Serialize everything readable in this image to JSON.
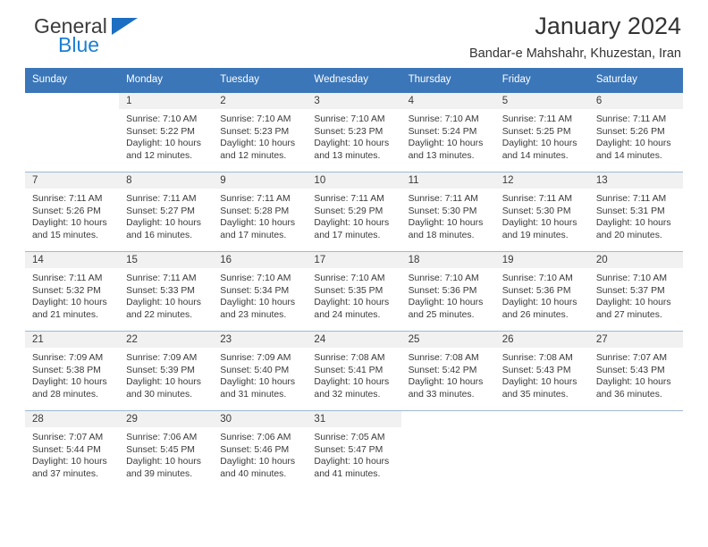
{
  "brand": {
    "name_part1": "General",
    "name_part2": "Blue",
    "accent_color": "#1b7fd4",
    "triangle_color": "#1b6ec2"
  },
  "header": {
    "title": "January 2024",
    "subtitle": "Bandar-e Mahshahr, Khuzestan, Iran"
  },
  "theme": {
    "header_row_bg": "#3b76b9",
    "daynum_bg": "#f1f1f1",
    "row_divider": "#9fb8d4",
    "text": "#3a3a3a"
  },
  "calendar": {
    "weekday_headers": [
      "Sunday",
      "Monday",
      "Tuesday",
      "Wednesday",
      "Thursday",
      "Friday",
      "Saturday"
    ],
    "weeks": [
      [
        {
          "day": "",
          "blank": true
        },
        {
          "day": "1",
          "sunrise": "Sunrise: 7:10 AM",
          "sunset": "Sunset: 5:22 PM",
          "daylight_line1": "Daylight: 10 hours",
          "daylight_line2": "and 12 minutes."
        },
        {
          "day": "2",
          "sunrise": "Sunrise: 7:10 AM",
          "sunset": "Sunset: 5:23 PM",
          "daylight_line1": "Daylight: 10 hours",
          "daylight_line2": "and 12 minutes."
        },
        {
          "day": "3",
          "sunrise": "Sunrise: 7:10 AM",
          "sunset": "Sunset: 5:23 PM",
          "daylight_line1": "Daylight: 10 hours",
          "daylight_line2": "and 13 minutes."
        },
        {
          "day": "4",
          "sunrise": "Sunrise: 7:10 AM",
          "sunset": "Sunset: 5:24 PM",
          "daylight_line1": "Daylight: 10 hours",
          "daylight_line2": "and 13 minutes."
        },
        {
          "day": "5",
          "sunrise": "Sunrise: 7:11 AM",
          "sunset": "Sunset: 5:25 PM",
          "daylight_line1": "Daylight: 10 hours",
          "daylight_line2": "and 14 minutes."
        },
        {
          "day": "6",
          "sunrise": "Sunrise: 7:11 AM",
          "sunset": "Sunset: 5:26 PM",
          "daylight_line1": "Daylight: 10 hours",
          "daylight_line2": "and 14 minutes."
        }
      ],
      [
        {
          "day": "7",
          "sunrise": "Sunrise: 7:11 AM",
          "sunset": "Sunset: 5:26 PM",
          "daylight_line1": "Daylight: 10 hours",
          "daylight_line2": "and 15 minutes."
        },
        {
          "day": "8",
          "sunrise": "Sunrise: 7:11 AM",
          "sunset": "Sunset: 5:27 PM",
          "daylight_line1": "Daylight: 10 hours",
          "daylight_line2": "and 16 minutes."
        },
        {
          "day": "9",
          "sunrise": "Sunrise: 7:11 AM",
          "sunset": "Sunset: 5:28 PM",
          "daylight_line1": "Daylight: 10 hours",
          "daylight_line2": "and 17 minutes."
        },
        {
          "day": "10",
          "sunrise": "Sunrise: 7:11 AM",
          "sunset": "Sunset: 5:29 PM",
          "daylight_line1": "Daylight: 10 hours",
          "daylight_line2": "and 17 minutes."
        },
        {
          "day": "11",
          "sunrise": "Sunrise: 7:11 AM",
          "sunset": "Sunset: 5:30 PM",
          "daylight_line1": "Daylight: 10 hours",
          "daylight_line2": "and 18 minutes."
        },
        {
          "day": "12",
          "sunrise": "Sunrise: 7:11 AM",
          "sunset": "Sunset: 5:30 PM",
          "daylight_line1": "Daylight: 10 hours",
          "daylight_line2": "and 19 minutes."
        },
        {
          "day": "13",
          "sunrise": "Sunrise: 7:11 AM",
          "sunset": "Sunset: 5:31 PM",
          "daylight_line1": "Daylight: 10 hours",
          "daylight_line2": "and 20 minutes."
        }
      ],
      [
        {
          "day": "14",
          "sunrise": "Sunrise: 7:11 AM",
          "sunset": "Sunset: 5:32 PM",
          "daylight_line1": "Daylight: 10 hours",
          "daylight_line2": "and 21 minutes."
        },
        {
          "day": "15",
          "sunrise": "Sunrise: 7:11 AM",
          "sunset": "Sunset: 5:33 PM",
          "daylight_line1": "Daylight: 10 hours",
          "daylight_line2": "and 22 minutes."
        },
        {
          "day": "16",
          "sunrise": "Sunrise: 7:10 AM",
          "sunset": "Sunset: 5:34 PM",
          "daylight_line1": "Daylight: 10 hours",
          "daylight_line2": "and 23 minutes."
        },
        {
          "day": "17",
          "sunrise": "Sunrise: 7:10 AM",
          "sunset": "Sunset: 5:35 PM",
          "daylight_line1": "Daylight: 10 hours",
          "daylight_line2": "and 24 minutes."
        },
        {
          "day": "18",
          "sunrise": "Sunrise: 7:10 AM",
          "sunset": "Sunset: 5:36 PM",
          "daylight_line1": "Daylight: 10 hours",
          "daylight_line2": "and 25 minutes."
        },
        {
          "day": "19",
          "sunrise": "Sunrise: 7:10 AM",
          "sunset": "Sunset: 5:36 PM",
          "daylight_line1": "Daylight: 10 hours",
          "daylight_line2": "and 26 minutes."
        },
        {
          "day": "20",
          "sunrise": "Sunrise: 7:10 AM",
          "sunset": "Sunset: 5:37 PM",
          "daylight_line1": "Daylight: 10 hours",
          "daylight_line2": "and 27 minutes."
        }
      ],
      [
        {
          "day": "21",
          "sunrise": "Sunrise: 7:09 AM",
          "sunset": "Sunset: 5:38 PM",
          "daylight_line1": "Daylight: 10 hours",
          "daylight_line2": "and 28 minutes."
        },
        {
          "day": "22",
          "sunrise": "Sunrise: 7:09 AM",
          "sunset": "Sunset: 5:39 PM",
          "daylight_line1": "Daylight: 10 hours",
          "daylight_line2": "and 30 minutes."
        },
        {
          "day": "23",
          "sunrise": "Sunrise: 7:09 AM",
          "sunset": "Sunset: 5:40 PM",
          "daylight_line1": "Daylight: 10 hours",
          "daylight_line2": "and 31 minutes."
        },
        {
          "day": "24",
          "sunrise": "Sunrise: 7:08 AM",
          "sunset": "Sunset: 5:41 PM",
          "daylight_line1": "Daylight: 10 hours",
          "daylight_line2": "and 32 minutes."
        },
        {
          "day": "25",
          "sunrise": "Sunrise: 7:08 AM",
          "sunset": "Sunset: 5:42 PM",
          "daylight_line1": "Daylight: 10 hours",
          "daylight_line2": "and 33 minutes."
        },
        {
          "day": "26",
          "sunrise": "Sunrise: 7:08 AM",
          "sunset": "Sunset: 5:43 PM",
          "daylight_line1": "Daylight: 10 hours",
          "daylight_line2": "and 35 minutes."
        },
        {
          "day": "27",
          "sunrise": "Sunrise: 7:07 AM",
          "sunset": "Sunset: 5:43 PM",
          "daylight_line1": "Daylight: 10 hours",
          "daylight_line2": "and 36 minutes."
        }
      ],
      [
        {
          "day": "28",
          "sunrise": "Sunrise: 7:07 AM",
          "sunset": "Sunset: 5:44 PM",
          "daylight_line1": "Daylight: 10 hours",
          "daylight_line2": "and 37 minutes."
        },
        {
          "day": "29",
          "sunrise": "Sunrise: 7:06 AM",
          "sunset": "Sunset: 5:45 PM",
          "daylight_line1": "Daylight: 10 hours",
          "daylight_line2": "and 39 minutes."
        },
        {
          "day": "30",
          "sunrise": "Sunrise: 7:06 AM",
          "sunset": "Sunset: 5:46 PM",
          "daylight_line1": "Daylight: 10 hours",
          "daylight_line2": "and 40 minutes."
        },
        {
          "day": "31",
          "sunrise": "Sunrise: 7:05 AM",
          "sunset": "Sunset: 5:47 PM",
          "daylight_line1": "Daylight: 10 hours",
          "daylight_line2": "and 41 minutes."
        },
        {
          "day": "",
          "blank": true
        },
        {
          "day": "",
          "blank": true
        },
        {
          "day": "",
          "blank": true
        }
      ]
    ]
  }
}
